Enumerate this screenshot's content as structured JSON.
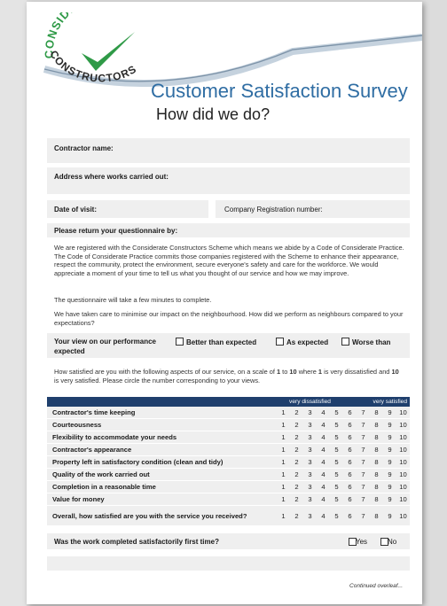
{
  "logo": {
    "top_text": "CONSIDERATE",
    "bottom_text": "CONSTRUCTORS",
    "brand_color": "#2f9a47"
  },
  "header": {
    "title": "Customer Satisfaction Survey",
    "subtitle": "How did we do?"
  },
  "fields": {
    "contractor_name": "Contractor name:",
    "address": "Address where works carried out:",
    "date_of_visit": "Date of visit:",
    "company_registration": "Company Registration number:",
    "return_by": "Please return your questionnaire by:"
  },
  "intro": {
    "p1": "We are registered with the Considerate Constructors Scheme which means we abide by a Code of Considerate Practice. The Code of Considerate Practice commits those companies registered with the Scheme to enhance their appearance, respect the community, protect the environment, secure everyone's safety and care for the workforce. We would appreciate a moment of your time to tell us what you thought of our service and how we may improve.",
    "p2": "The questionnaire will take a few minutes to complete.",
    "p3": "We have taken care to minimise our impact on the neighbourhood. How did we perform as neighbours compared to your expectations?"
  },
  "performance": {
    "label_line1": "Your view on our performance",
    "label_line2": "expected",
    "options": [
      "Better than expected",
      "As expected",
      "Worse than"
    ]
  },
  "scale_instructions": {
    "a": "How satisfied are you with the following aspects of our service, on a scale of ",
    "b": "1",
    "c": " to ",
    "d": "10",
    "e": " where ",
    "f": "1",
    "g": " is very dissatisfied and ",
    "h": "10",
    "i": " is very satisfied.  Please circle the number corresponding to your views."
  },
  "ratings": {
    "low_label": "very dissatisfied",
    "high_label": "very satisfied",
    "scale": [
      "1",
      "2",
      "3",
      "4",
      "5",
      "6",
      "7",
      "8",
      "9",
      "10"
    ],
    "items": [
      "Contractor's time keeping",
      "Courteousness",
      "Flexibility to accommodate your needs",
      "Contractor's appearance",
      "Property left in satisfactory condition (clean and tidy)",
      "Quality of the work carried out",
      "Completion in a reasonable time",
      "Value for money",
      "Overall, how satisfied are you with the service you received?"
    ]
  },
  "first_time": {
    "question": "Was the work completed satisfactorily first time?",
    "yes": "Yes",
    "no": "No"
  },
  "footer": "Continued overleaf..."
}
